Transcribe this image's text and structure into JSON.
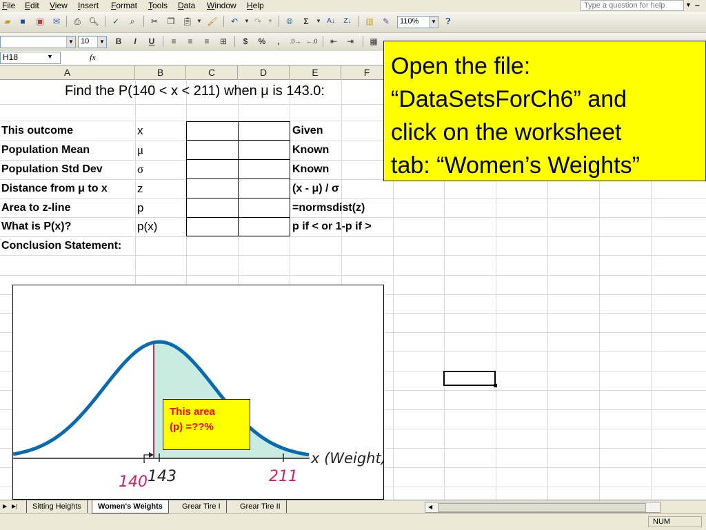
{
  "menu": {
    "items": [
      "File",
      "Edit",
      "View",
      "Insert",
      "Format",
      "Tools",
      "Data",
      "Window",
      "Help"
    ],
    "help_placeholder": "Type a question for help"
  },
  "toolbar": {
    "zoom": "110%",
    "font_size": "10",
    "bold": "B",
    "italic": "I",
    "underline": "U",
    "currency": "$",
    "percent": "%",
    "comma": ",",
    "sigma": "Σ"
  },
  "formula": {
    "name_box": "H18",
    "fx": "fx",
    "value": ""
  },
  "columns": [
    "A",
    "B",
    "C",
    "D",
    "E",
    "F"
  ],
  "sheet": {
    "title": "Find the P(140 < x < 211) when μ is 143.0:",
    "rows": [
      {
        "a": "This outcome",
        "b": "x",
        "e": "Given"
      },
      {
        "a": "Population Mean",
        "b": "μ",
        "e": "Known"
      },
      {
        "a": "Population Std Dev",
        "b": "σ",
        "e": "Known"
      },
      {
        "a": "Distance from μ to x",
        "b": "z",
        "e": "(x - μ) / σ"
      },
      {
        "a": "Area to z-line",
        "b": "p",
        "e": "=normsdist(z)"
      },
      {
        "a": "What is P(x)?",
        "b": "p(x)",
        "e": "p if  < or 1-p if  >"
      }
    ],
    "conclusion": "Conclusion Statement:"
  },
  "chart": {
    "area_label_line1": "This area",
    "area_label_line2": "(p) =??%",
    "x_axis_label": "x (Weight)",
    "tick_140": "140",
    "tick_143": "143",
    "tick_211": "211",
    "mean_value": 143,
    "lower_value": 140,
    "upper_value": 211
  },
  "callout": {
    "line1": "Open the file:",
    "line2": "“DataSetsForCh6” and",
    "line3": "click on the worksheet",
    "line4": "tab: “Women’s Weights”"
  },
  "tabs": [
    "Sitting Heights",
    "Women's Weights",
    "Grear Tire I",
    "Grear Tire II"
  ],
  "active_tab": "Women's Weights",
  "status": {
    "mode": "NUM"
  },
  "colors": {
    "callout_bg": "#ffff00",
    "curve": "#0a6ab0",
    "shaded_area": "#c8ecdf",
    "mean_line": "#d0206a",
    "label_red": "#ff0000"
  }
}
